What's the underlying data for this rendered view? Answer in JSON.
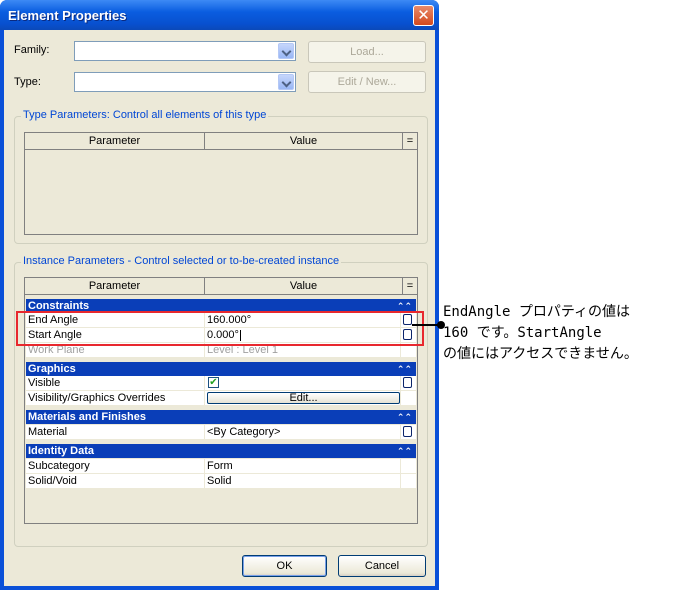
{
  "window": {
    "title": "Element Properties"
  },
  "header": {
    "family_label": "Family:",
    "type_label": "Type:",
    "load_button": "Load...",
    "edit_new_button": "Edit / New..."
  },
  "type_parameters": {
    "title": "Type Parameters: Control all elements of this type",
    "columns": [
      "Parameter",
      "Value",
      "="
    ]
  },
  "instance_parameters": {
    "title": "Instance Parameters - Control selected or to-be-created instance",
    "columns": [
      "Parameter",
      "Value",
      "="
    ],
    "categories": {
      "constraints": "Constraints",
      "graphics": "Graphics",
      "materials": "Materials and Finishes",
      "identity": "Identity Data"
    },
    "rows": {
      "end_angle": {
        "name": "End Angle",
        "value": "160.000°"
      },
      "start_angle": {
        "name": "Start Angle",
        "value": "0.000°"
      },
      "work_plane": {
        "name": "Work Plane",
        "value": "Level : Level 1"
      },
      "visible": {
        "name": "Visible",
        "value": "✔"
      },
      "vis_overrides": {
        "name": "Visibility/Graphics Overrides",
        "value": "Edit..."
      },
      "material": {
        "name": "Material",
        "value": "<By Category>"
      },
      "subcategory": {
        "name": "Subcategory",
        "value": "Form"
      },
      "solid_void": {
        "name": "Solid/Void",
        "value": "Solid"
      }
    }
  },
  "footer": {
    "ok_button": "OK",
    "cancel_button": "Cancel"
  },
  "callout": {
    "line1": "EndAngle プロパティの値は",
    "line2": "160 です。StartAngle",
    "line3": "の値にはアクセスできません。"
  },
  "colors": {
    "title_bar": "#0a5de0",
    "category_header": "#0a3eb8",
    "highlight": "#e8282e",
    "group_title": "#0046d5"
  }
}
